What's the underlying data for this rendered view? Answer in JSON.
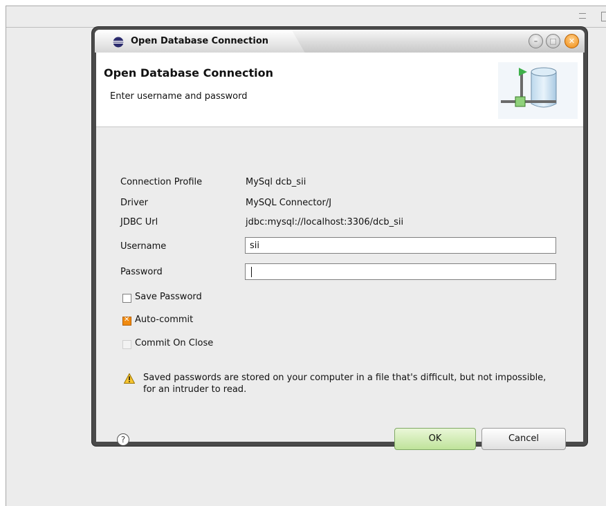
{
  "dialog": {
    "window_title": "Open Database Connection",
    "header_title": "Open Database Connection",
    "header_description": "Enter username and password"
  },
  "fields": {
    "connection_profile_label": "Connection Profile",
    "connection_profile_value": "MySql dcb_sii",
    "driver_label": "Driver",
    "driver_value": "MySQL Connector/J",
    "jdbc_url_label": "JDBC Url",
    "jdbc_url_value": "jdbc:mysql://localhost:3306/dcb_sii",
    "username_label": "Username",
    "username_value": "sii",
    "password_label": "Password",
    "password_value": ""
  },
  "options": {
    "save_password_label": "Save Password",
    "save_password_checked": false,
    "auto_commit_label": "Auto-commit",
    "auto_commit_checked": true,
    "commit_on_close_label": "Commit On Close",
    "commit_on_close_enabled": false
  },
  "warning": {
    "text": "Saved passwords are stored on your computer in a file that's difficult, but not impossible, for an intruder to read."
  },
  "buttons": {
    "ok_label": "OK",
    "cancel_label": "Cancel",
    "help_glyph": "?"
  },
  "colors": {
    "accent_orange": "#f08a10",
    "ok_button_green": "#bfe39a"
  }
}
